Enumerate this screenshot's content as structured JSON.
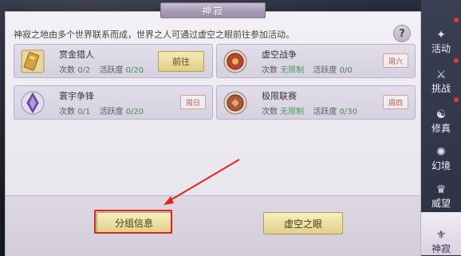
{
  "window": {
    "title": "神寂"
  },
  "description": "神寂之地由多个世界联系而成，世界之人可通过虚空之眼前往参加活动。",
  "help": {
    "icon": "question-mark-icon",
    "label": "?"
  },
  "labels": {
    "count": "次数",
    "activity": "活跃度"
  },
  "activities": [
    {
      "name": "赏金猎人",
      "count": "0/2",
      "activity": "0/20",
      "icon": "gold-token-icon",
      "action": "前往"
    },
    {
      "name": "虚空战争",
      "count": "无限制",
      "activity": "0/0",
      "icon": "red-emblem-icon",
      "day": "周六"
    },
    {
      "name": "寰宇争锋",
      "count": "0/1",
      "activity": "0/20",
      "icon": "purple-crystal-icon",
      "day": "周日"
    },
    {
      "name": "极限联赛",
      "count": "无限制",
      "activity": "0/30",
      "icon": "bronze-medal-icon",
      "day": "周四"
    }
  ],
  "buttons": {
    "group_info": "分组信息",
    "void_eye": "虚空之眼"
  },
  "sidebar": {
    "items": [
      {
        "label": "活动",
        "icon": "activity-icon"
      },
      {
        "label": "挑战",
        "icon": "challenge-icon"
      },
      {
        "label": "修真",
        "icon": "cultivation-icon"
      },
      {
        "label": "幻境",
        "icon": "illusion-icon"
      },
      {
        "label": "威望",
        "icon": "prestige-icon"
      },
      {
        "label": "神寂",
        "icon": "shenji-icon"
      }
    ],
    "active_index": 5
  },
  "colors": {
    "highlight": "#e2241c",
    "accent_gold": "#e0d18b",
    "tag_red": "#c0583d"
  }
}
